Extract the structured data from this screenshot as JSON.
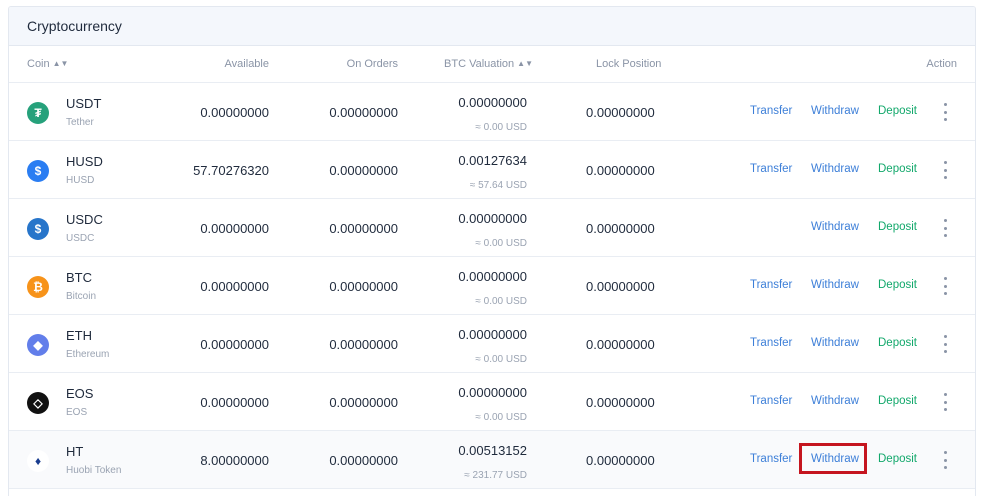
{
  "panel": {
    "title": "Cryptocurrency"
  },
  "headers": {
    "coin": "Coin",
    "available": "Available",
    "on_orders": "On Orders",
    "btc_valuation": "BTC Valuation",
    "lock_position": "Lock Position",
    "action": "Action"
  },
  "actions": {
    "transfer": "Transfer",
    "withdraw": "Withdraw",
    "deposit": "Deposit"
  },
  "rows": [
    {
      "symbol": "USDT",
      "name": "Tether",
      "available": "0.00000000",
      "on_orders": "0.00000000",
      "btc": "0.00000000",
      "usd": "≈ 0.00 USD",
      "lock": "0.00000000",
      "icon": "tether-icon",
      "icon_glyph": "₮",
      "color": "#26a17b",
      "has_transfer": true
    },
    {
      "symbol": "HUSD",
      "name": "HUSD",
      "available": "57.70276320",
      "on_orders": "0.00000000",
      "btc": "0.00127634",
      "usd": "≈ 57.64 USD",
      "lock": "0.00000000",
      "icon": "husd-icon",
      "icon_glyph": "$",
      "color": "#2a7df2",
      "has_transfer": true
    },
    {
      "symbol": "USDC",
      "name": "USDC",
      "available": "0.00000000",
      "on_orders": "0.00000000",
      "btc": "0.00000000",
      "usd": "≈ 0.00 USD",
      "lock": "0.00000000",
      "icon": "usdc-icon",
      "icon_glyph": "$",
      "color": "#2775ca",
      "has_transfer": false
    },
    {
      "symbol": "BTC",
      "name": "Bitcoin",
      "available": "0.00000000",
      "on_orders": "0.00000000",
      "btc": "0.00000000",
      "usd": "≈ 0.00 USD",
      "lock": "0.00000000",
      "icon": "bitcoin-icon",
      "icon_glyph": "₿",
      "color": "#f7931a",
      "has_transfer": true
    },
    {
      "symbol": "ETH",
      "name": "Ethereum",
      "available": "0.00000000",
      "on_orders": "0.00000000",
      "btc": "0.00000000",
      "usd": "≈ 0.00 USD",
      "lock": "0.00000000",
      "icon": "ethereum-icon",
      "icon_glyph": "◆",
      "color": "#627eea",
      "has_transfer": true
    },
    {
      "symbol": "EOS",
      "name": "EOS",
      "available": "0.00000000",
      "on_orders": "0.00000000",
      "btc": "0.00000000",
      "usd": "≈ 0.00 USD",
      "lock": "0.00000000",
      "icon": "eos-icon",
      "icon_glyph": "◇",
      "color": "#111111",
      "has_transfer": true
    },
    {
      "symbol": "HT",
      "name": "Huobi Token",
      "available": "8.00000000",
      "on_orders": "0.00000000",
      "btc": "0.00513152",
      "usd": "≈ 231.77 USD",
      "lock": "0.00000000",
      "icon": "huobi-token-icon",
      "icon_glyph": "♦",
      "color": "#ffffff",
      "glyph_color": "#1a3d8f",
      "has_transfer": true,
      "highlight_withdraw": true
    }
  ]
}
